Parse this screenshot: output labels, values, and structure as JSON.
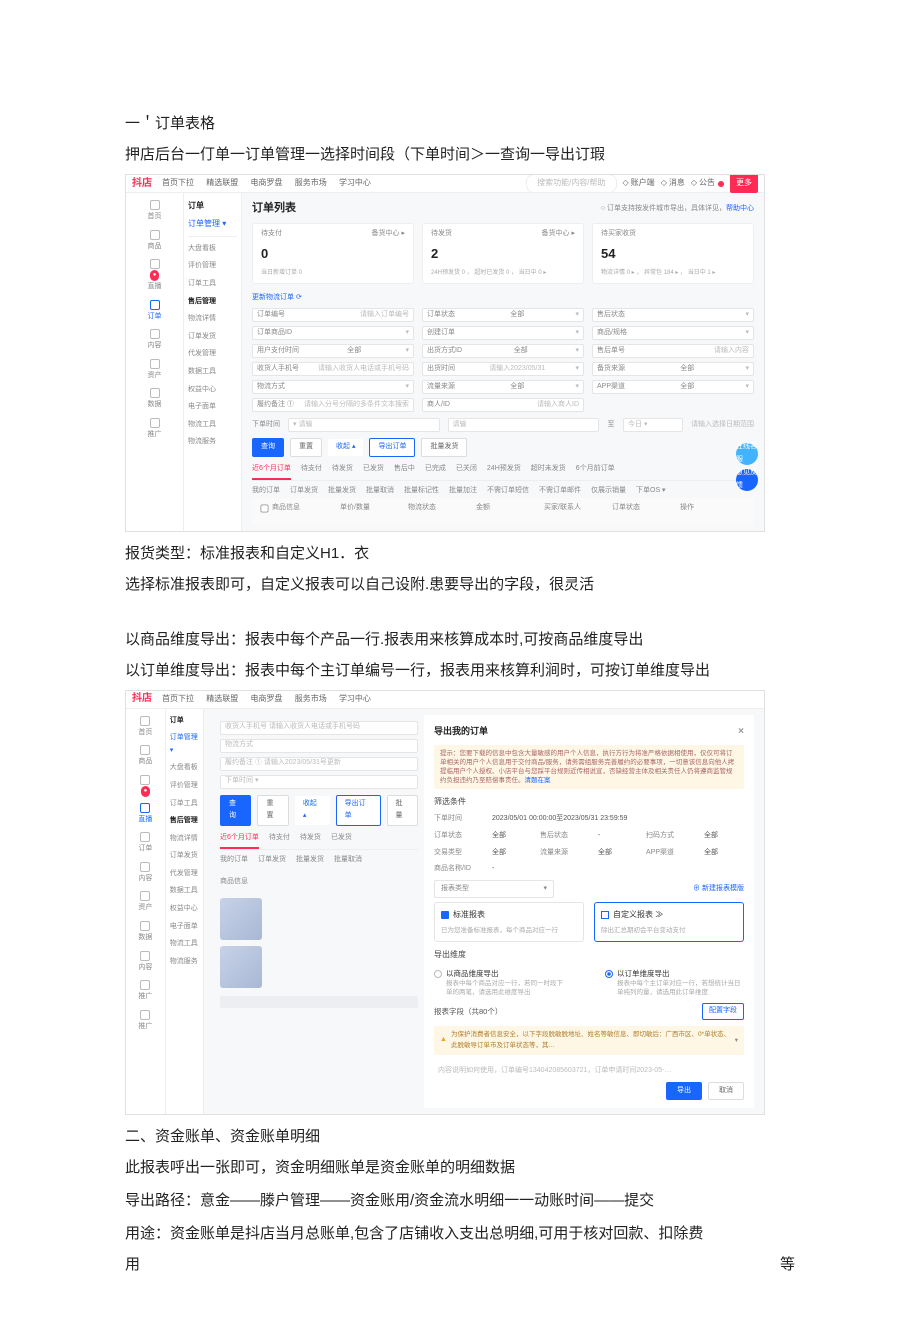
{
  "doc": {
    "h1": "一＇订单表格",
    "p1": "押店后台一仃单一订单管理一选择时间段（下单时间＞一查询一导出订瑕",
    "p2": "报货类型：标准报表和自定义H1．衣",
    "p3": "选择标准报表即可，自定义报表可以自己设附.患要导出的字段，很灵活",
    "p4": "以商品维度导出：报表中每个产品一行.报表用来核算成本时,可按商品维度导出",
    "p5": "以订单维度导出：报表中每个主订单编号一行，报表用来核算利涧时，可按订单维度导出",
    "h2": "二、资金账单、资金账单明细",
    "p6": "此报表呼出一张即可，资金明细账单是资金账单的明细数据",
    "p7": "导出路径：意金——滕户管理——资金账用/资金流水明细一一动账时间——提交",
    "p8_left": "用途：资金账单是抖店当月总账单,包含了店铺收入支出总明细,可用于核对回款、扣除费",
    "p9_left": "用",
    "p9_right": "等"
  },
  "shot1": {
    "brand": "抖店",
    "topnav": [
      "首页下拉",
      "精选联盟",
      "电商罗盘",
      "服务市场",
      "学习中心"
    ],
    "search_ph": "搜索功能/内容/帮助",
    "toplinks": {
      "user": "账户端",
      "msg": "消息",
      "notice": "公告",
      "more": "更多"
    },
    "side": [
      {
        "label": "首页"
      },
      {
        "label": "商品"
      },
      {
        "label": "直播"
      },
      {
        "label": "订单"
      },
      {
        "label": "内容"
      },
      {
        "label": "资产"
      },
      {
        "label": "数据"
      },
      {
        "label": "推广"
      }
    ],
    "subnav": {
      "a": "订单",
      "b": "订单管理",
      "c": "▾"
    },
    "subside": [
      "大盘看板",
      "评价管理",
      "订单工具",
      "售后管理",
      "物流详情",
      "订单发货",
      "代发管理",
      "数据工具",
      "权益中心",
      "电子面单",
      "物流工具",
      "物流服务"
    ],
    "title": "订单列表",
    "hint_pre": "○ 订单支持按发件城市导出，具体详见，",
    "hint_link": "帮助中心",
    "stats": [
      {
        "lab": "待支付",
        "corner": "备货中心 ▸",
        "num": "0",
        "sub": "当日新增订单 0"
      },
      {
        "lab": "待发货",
        "corner": "备货中心 ▸",
        "num": "2",
        "sub": "24H预发货 0 ， 超时已发货 0 ， 当日中 0 ▸"
      },
      {
        "lab": "待买家收货",
        "corner": "",
        "num": "54",
        "sub": "物流详情 0 ▸ ， 异常包 184 ▸ ， 当日中 1 ▸"
      }
    ],
    "refresh": "更新物流订单 ⟳",
    "filters": [
      {
        "l": "订单编号",
        "v": "请输入订单编号"
      },
      {
        "l": "订单状态",
        "v": "全部"
      },
      {
        "l": "售后状态",
        "v": ""
      },
      {
        "l": "订单商品ID",
        "v": ""
      },
      {
        "l": "创建订单",
        "v": ""
      },
      {
        "l": "商品/规格",
        "v": ""
      },
      {
        "l": "用户支付时间",
        "v": "全部"
      },
      {
        "l": "出货方式ID",
        "v": "全部"
      },
      {
        "l": "售后单号",
        "v": "请输入内容"
      },
      {
        "l": "收货人手机号",
        "v": "请输入收货人电话或手机号码"
      },
      {
        "l": "出货时间",
        "v": "请输入2023/05/31"
      },
      {
        "l": "备货来源",
        "v": "全部"
      },
      {
        "l": "物流方式",
        "v": ""
      },
      {
        "l": "流量来源",
        "v": "全部"
      },
      {
        "l": "APP渠道",
        "v": "全部"
      },
      {
        "l": "履约备注 ①",
        "v": "请输入分号分隔的多条件文本搜索"
      },
      {
        "l": "商人/ID",
        "v": "请输入商人ID"
      }
    ],
    "amount": {
      "lab": "下单时间",
      "op": "▾",
      "v": "",
      "to": "今日 ▾",
      "ph": "请输",
      "date": "请输入选择日期范围"
    },
    "btns": {
      "q": "查询",
      "r": "重置",
      "more": "收起 ▴",
      "export": "导出订单",
      "batch": "批量发货"
    },
    "tabs2": [
      "近6个月订单",
      "待支付",
      "待发货",
      "已发货",
      "售后中",
      "已完成",
      "已关闭",
      "24H预发货",
      "超时未发货",
      "6个月前订单"
    ],
    "subtabs": [
      "我的订单",
      "订单发货",
      "批量发货",
      "批量取消",
      "批量标记性",
      "批量加注",
      "不需订单短信",
      "不需订单邮件",
      "仅展示销量",
      "下单OS ▾"
    ],
    "th": [
      "",
      "商品信息",
      "单价/数量",
      "物流状态",
      "金额",
      "买家/联系人",
      "订单状态",
      "操作"
    ],
    "float1": "在线客服",
    "float2": "意见反馈"
  },
  "shot2": {
    "brand": "抖店",
    "topnav": [
      "首页下拉",
      "精选联盟",
      "电商罗盘",
      "服务市场",
      "学习中心"
    ],
    "side_labels": [
      "首页",
      "商品",
      "",
      "直播",
      "订单",
      "内容",
      "资产",
      "",
      "数据",
      "内容",
      "推广",
      "推广"
    ],
    "subnav": [
      "订单",
      "订单管理",
      "▾",
      "————",
      "大盘看板",
      "评价管理",
      "订单工具",
      "售后管理",
      "物流详情",
      "订单发货",
      "代发管理",
      "数据工具",
      "权益中心",
      "电子面单",
      "物流工具",
      "物流服务"
    ],
    "left": {
      "f1": "收货人手机号  请输入收货人电话或手机号码",
      "f2": "物流方式  ",
      "f3": "履约备注 ①  请输入2023/05/31号更新",
      "amt": "下单时间  ▾  ",
      "btns": [
        "查询",
        "重置",
        "收起 ▴",
        "导出订单",
        "批量"
      ],
      "tabs": [
        "近6个月订单",
        "待支付",
        "待发货",
        "已发货"
      ],
      "subtabs": [
        "我的订单",
        "订单发货",
        "批量发货",
        "批量取消"
      ],
      "prod": "商品信息"
    },
    "modal": {
      "title": "导出我的订单",
      "notice": "提示：您要下载的信息中包含大量敏感的用户个人信息，执行方行为将准严格依据相使用，仅仅可将订单相关的用户个人信息用于交付商品/服务，请务需组服务完善履约的必要事项，一切意该信息向他人拷提临用户个人授权、小店平台与您踩平台规则近传相说宣，否缺经营主体及相关责任人仍将遵商监管规约负担违约乃至赔偿事责任。",
      "notice_link": "清题在案",
      "sec1": "筛选条件",
      "kv": {
        "k1": "下单时间",
        "v1": "2023/05/01 00:00:00至2023/05/31 23:59:59",
        "k2": "订单状态",
        "v2": "全部",
        "k3": "售后状态",
        "v3": "-",
        "k4": "扫码方式",
        "v4": "全部",
        "k5": "交易类型",
        "v5": "全部",
        "k6": "流量来源",
        "v6": "全部",
        "k7": "APP渠道",
        "v7": "全部",
        "k8": "商品名称/ID",
        "v8": "-"
      },
      "sec2": "报表类型",
      "tpl_link": "⊕ 新建报表模版",
      "card1_h": "标准报表",
      "card1_d": "已为您准备标准报表，每个商品对应一行",
      "card2_h": "自定义报表 ≫",
      "card2_d": "除出汇总期初会平台变动支付",
      "sec3": "导出维度",
      "radio1_h": "以商品维度导出",
      "radio1_d": "报表中每个商品对应一行，若同一时段下单的两笔，请选用此维度导出",
      "radio2_h": "以订单维度导出",
      "radio2_d": "报表中每个主订单对应一行，若想统计当日单纯列的量，请选用此订单维度",
      "setf": "报表字段（共80个）",
      "setf_btn": "配置字段",
      "warn": "为保护消费者信息安全，以下字段脱敏脱地址、姓名等敏信息、即切敏后：广西市区、0*单状态、此脱敏导订单市及订单状态等，其…",
      "ph": "内容说明如何使用，订单编号134042085603721，订单申请时间2023-05-…",
      "ok": "导出",
      "cancel": "取消"
    }
  }
}
